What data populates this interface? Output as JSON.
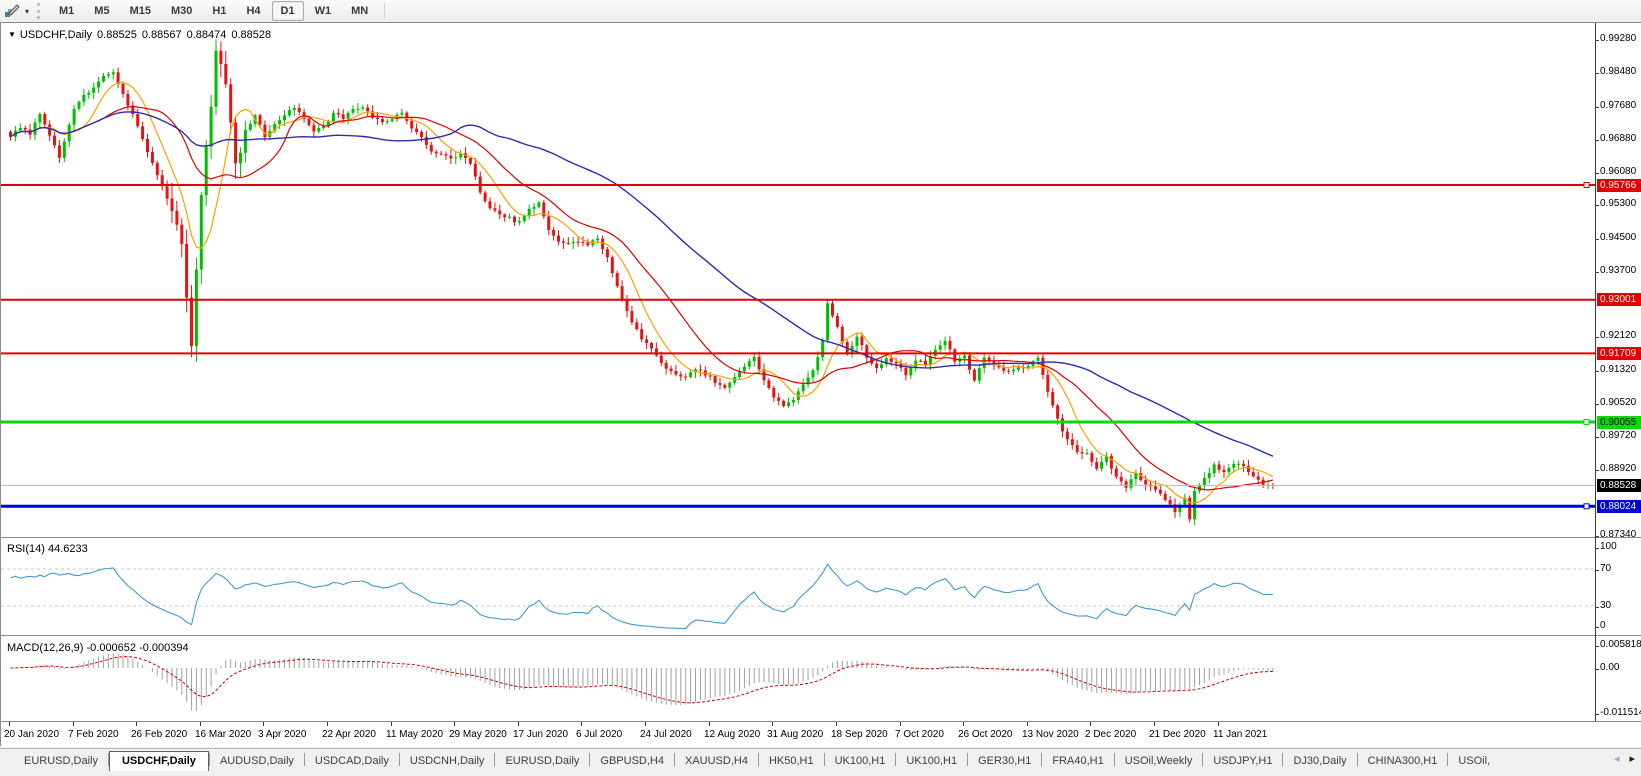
{
  "toolbar": {
    "timeframes": [
      "M1",
      "M5",
      "M15",
      "M30",
      "H1",
      "H4",
      "D1",
      "W1",
      "MN"
    ],
    "active": "D1"
  },
  "chart_header": {
    "symbol_label": "USDCHF,Daily",
    "open": "0.88525",
    "high": "0.88567",
    "low": "0.88474",
    "close": "0.88528"
  },
  "price_axis_ticks": [
    "0.99280",
    "0.98480",
    "0.97680",
    "0.96880",
    "0.96080",
    "0.95300",
    "0.94500",
    "0.93700",
    "0.92120",
    "0.91320",
    "0.90520",
    "0.89720",
    "0.88920",
    "0.87340"
  ],
  "rsi_panel": {
    "name": "RSI(14)",
    "value": "44.6233",
    "axis": [
      "100",
      "70",
      "30",
      "0"
    ],
    "axis_values": [
      100,
      70,
      30,
      0
    ],
    "level_lines": [
      70,
      30
    ]
  },
  "macd_panel": {
    "name": "MACD(12,26,9)",
    "value1": "-0.000652",
    "value2": "-0.000394",
    "axis": [
      "0.005818",
      "0.00",
      "-0.011514"
    ],
    "axis_values": [
      0.005818,
      0,
      -0.011514
    ]
  },
  "date_axis": [
    "20 Jan 2020",
    "7 Feb 2020",
    "26 Feb 2020",
    "16 Mar 2020",
    "3 Apr 2020",
    "22 Apr 2020",
    "11 May 2020",
    "29 May 2020",
    "17 Jun 2020",
    "6 Jul 2020",
    "24 Jul 2020",
    "12 Aug 2020",
    "31 Aug 2020",
    "18 Sep 2020",
    "7 Oct 2020",
    "26 Oct 2020",
    "13 Nov 2020",
    "2 Dec 2020",
    "21 Dec 2020",
    "11 Jan 2021"
  ],
  "tabs": {
    "items": [
      {
        "label": "EURUSD,Daily",
        "active": false
      },
      {
        "label": "USDCHF,Daily",
        "active": true
      },
      {
        "label": "AUDUSD,Daily",
        "active": false
      },
      {
        "label": "USDCAD,Daily",
        "active": false
      },
      {
        "label": "USDCNH,Daily",
        "active": false
      },
      {
        "label": "EURUSD,Daily",
        "active": false
      },
      {
        "label": "GBPUSD,H4",
        "active": false
      },
      {
        "label": "XAUUSD,H4",
        "active": false
      },
      {
        "label": "HK50,H1",
        "active": false
      },
      {
        "label": "UK100,H1",
        "active": false
      },
      {
        "label": "UK100,H1",
        "active": false
      },
      {
        "label": "GER30,H1",
        "active": false
      },
      {
        "label": "FRA40,H1",
        "active": false
      },
      {
        "label": "USOil,Weekly",
        "active": false
      },
      {
        "label": "USDJPY,H1",
        "active": false
      },
      {
        "label": "DJ30,Daily",
        "active": false
      },
      {
        "label": "CHINA300,H1",
        "active": false
      },
      {
        "label": "USOil,",
        "active": false
      }
    ],
    "scroll_left": "◂",
    "scroll_right": "▸"
  },
  "chart_data": {
    "type": "candlestick",
    "instrument": "USDCHF",
    "timeframe": "Daily",
    "last_ohlc": {
      "open": 0.88525,
      "high": 0.88567,
      "low": 0.88474,
      "close": 0.88528
    },
    "y_axis_range": [
      0.8734,
      0.9928
    ],
    "x_axis_labels": [
      "20 Jan 2020",
      "7 Feb 2020",
      "26 Feb 2020",
      "16 Mar 2020",
      "3 Apr 2020",
      "22 Apr 2020",
      "11 May 2020",
      "29 May 2020",
      "17 Jun 2020",
      "6 Jul 2020",
      "24 Jul 2020",
      "12 Aug 2020",
      "31 Aug 2020",
      "18 Sep 2020",
      "7 Oct 2020",
      "26 Oct 2020",
      "13 Nov 2020",
      "2 Dec 2020",
      "21 Dec 2020",
      "11 Jan 2021"
    ],
    "bars_per_label": 13,
    "grid": false,
    "colors": {
      "bull": "#00bf00",
      "bear": "#e41414",
      "ma_fast": "#ff9f00",
      "ma_mid": "#e00000",
      "ma_slow": "#2d2db4",
      "rsi_line": "#3f9bd8",
      "macd_hist": "#a0a0a0",
      "macd_signal": "#d40000",
      "bid_line": "#b8b8b8"
    },
    "moving_averages": [
      {
        "name": "ma-fast",
        "period": 8,
        "color": "#ff9f00"
      },
      {
        "name": "ma-mid",
        "period": 20,
        "color": "#e00000"
      },
      {
        "name": "ma-slow",
        "period": 55,
        "color": "#2d2db4"
      }
    ],
    "key_levels": [
      {
        "price": 0.95766,
        "label": "0.95766",
        "color": "#e00000",
        "width": 2,
        "text_color": "#ffffff",
        "label_bg": "#e00000",
        "kind": "resistance",
        "handle": true
      },
      {
        "price": 0.93001,
        "label": "0.93001",
        "color": "#e00000",
        "width": 2,
        "text_color": "#ffffff",
        "label_bg": "#e00000",
        "kind": "resistance",
        "handle": false
      },
      {
        "price": 0.91709,
        "label": "0.91709",
        "color": "#e00000",
        "width": 2,
        "text_color": "#ffffff",
        "label_bg": "#e00000",
        "kind": "resistance",
        "handle": false
      },
      {
        "price": 0.90055,
        "label": "0.90055",
        "color": "#00dd00",
        "width": 3,
        "text_color": "#000000",
        "label_bg": "#00dd00",
        "kind": "support",
        "handle": true
      },
      {
        "price": 0.88024,
        "label": "0.88024",
        "color": "#0000dd",
        "width": 3,
        "text_color": "#ffffff",
        "label_bg": "#0000dd",
        "kind": "support",
        "handle": true
      }
    ],
    "current_price": {
      "price": 0.88528,
      "label": "0.88528",
      "line_color": "#b8b8b8",
      "label_bg": "#000000",
      "text_color": "#ffffff"
    },
    "indicators": [
      {
        "name": "RSI",
        "period": 14,
        "current": 44.6233
      },
      {
        "name": "MACD",
        "fast": 12,
        "slow": 26,
        "signal": 9,
        "current_macd": -0.000652,
        "current_signal": -0.000394
      }
    ],
    "price_path": [
      [
        0,
        0.969
      ],
      [
        2,
        0.9717
      ],
      [
        4,
        0.97
      ],
      [
        6,
        0.9748
      ],
      [
        8,
        0.97
      ],
      [
        10,
        0.9645
      ],
      [
        13,
        0.9762
      ],
      [
        15,
        0.979
      ],
      [
        17,
        0.9812
      ],
      [
        19,
        0.9838
      ],
      [
        21,
        0.9848
      ],
      [
        23,
        0.98
      ],
      [
        25,
        0.9745
      ],
      [
        27,
        0.969
      ],
      [
        29,
        0.9625
      ],
      [
        31,
        0.957
      ],
      [
        33,
        0.9505
      ],
      [
        35,
        0.944
      ],
      [
        37,
        0.919
      ],
      [
        39,
        0.9555
      ],
      [
        41,
        0.977
      ],
      [
        42,
        0.9898
      ],
      [
        44,
        0.983
      ],
      [
        46,
        0.9625
      ],
      [
        48,
        0.97
      ],
      [
        50,
        0.9748
      ],
      [
        52,
        0.9692
      ],
      [
        54,
        0.9722
      ],
      [
        56,
        0.9748
      ],
      [
        58,
        0.9762
      ],
      [
        60,
        0.9738
      ],
      [
        62,
        0.9706
      ],
      [
        64,
        0.9722
      ],
      [
        66,
        0.9748
      ],
      [
        68,
        0.9738
      ],
      [
        70,
        0.9757
      ],
      [
        72,
        0.9766
      ],
      [
        74,
        0.9737
      ],
      [
        76,
        0.9732
      ],
      [
        78,
        0.9737
      ],
      [
        80,
        0.9747
      ],
      [
        82,
        0.9712
      ],
      [
        84,
        0.9688
      ],
      [
        86,
        0.9655
      ],
      [
        88,
        0.9652
      ],
      [
        90,
        0.964
      ],
      [
        92,
        0.9652
      ],
      [
        94,
        0.9625
      ],
      [
        96,
        0.9562
      ],
      [
        98,
        0.9518
      ],
      [
        100,
        0.9508
      ],
      [
        102,
        0.9496
      ],
      [
        104,
        0.9486
      ],
      [
        106,
        0.9516
      ],
      [
        108,
        0.9532
      ],
      [
        110,
        0.9472
      ],
      [
        112,
        0.9442
      ],
      [
        114,
        0.9432
      ],
      [
        116,
        0.9442
      ],
      [
        118,
        0.9432
      ],
      [
        120,
        0.9447
      ],
      [
        122,
        0.9402
      ],
      [
        124,
        0.9332
      ],
      [
        126,
        0.9272
      ],
      [
        128,
        0.9226
      ],
      [
        130,
        0.9192
      ],
      [
        132,
        0.9167
      ],
      [
        134,
        0.9137
      ],
      [
        136,
        0.9122
      ],
      [
        138,
        0.9112
      ],
      [
        140,
        0.9132
      ],
      [
        142,
        0.9122
      ],
      [
        144,
        0.9102
      ],
      [
        146,
        0.9087
      ],
      [
        148,
        0.9112
      ],
      [
        150,
        0.9142
      ],
      [
        152,
        0.9167
      ],
      [
        154,
        0.9102
      ],
      [
        156,
        0.9067
      ],
      [
        158,
        0.9042
      ],
      [
        160,
        0.9062
      ],
      [
        162,
        0.9092
      ],
      [
        164,
        0.9132
      ],
      [
        166,
        0.92
      ],
      [
        167,
        0.929
      ],
      [
        169,
        0.9232
      ],
      [
        171,
        0.9172
      ],
      [
        173,
        0.9212
      ],
      [
        175,
        0.9162
      ],
      [
        177,
        0.9132
      ],
      [
        179,
        0.9162
      ],
      [
        181,
        0.9142
      ],
      [
        183,
        0.9122
      ],
      [
        185,
        0.9157
      ],
      [
        187,
        0.9142
      ],
      [
        189,
        0.9182
      ],
      [
        191,
        0.9205
      ],
      [
        193,
        0.9152
      ],
      [
        195,
        0.9162
      ],
      [
        197,
        0.9102
      ],
      [
        199,
        0.9162
      ],
      [
        201,
        0.9142
      ],
      [
        203,
        0.9127
      ],
      [
        205,
        0.9132
      ],
      [
        208,
        0.9142
      ],
      [
        210,
        0.9157
      ],
      [
        212,
        0.9082
      ],
      [
        214,
        0.9012
      ],
      [
        216,
        0.8962
      ],
      [
        218,
        0.8937
      ],
      [
        220,
        0.8927
      ],
      [
        222,
        0.8892
      ],
      [
        224,
        0.8922
      ],
      [
        226,
        0.8872
      ],
      [
        228,
        0.8847
      ],
      [
        230,
        0.8882
      ],
      [
        232,
        0.8857
      ],
      [
        234,
        0.8842
      ],
      [
        236,
        0.8817
      ],
      [
        238,
        0.8792
      ],
      [
        240,
        0.8827
      ],
      [
        241,
        0.8772
      ],
      [
        242,
        0.8842
      ],
      [
        244,
        0.8867
      ],
      [
        246,
        0.8902
      ],
      [
        248,
        0.8887
      ],
      [
        250,
        0.8907
      ],
      [
        252,
        0.8897
      ],
      [
        254,
        0.8872
      ],
      [
        256,
        0.8857
      ],
      [
        258,
        0.88528
      ]
    ]
  }
}
